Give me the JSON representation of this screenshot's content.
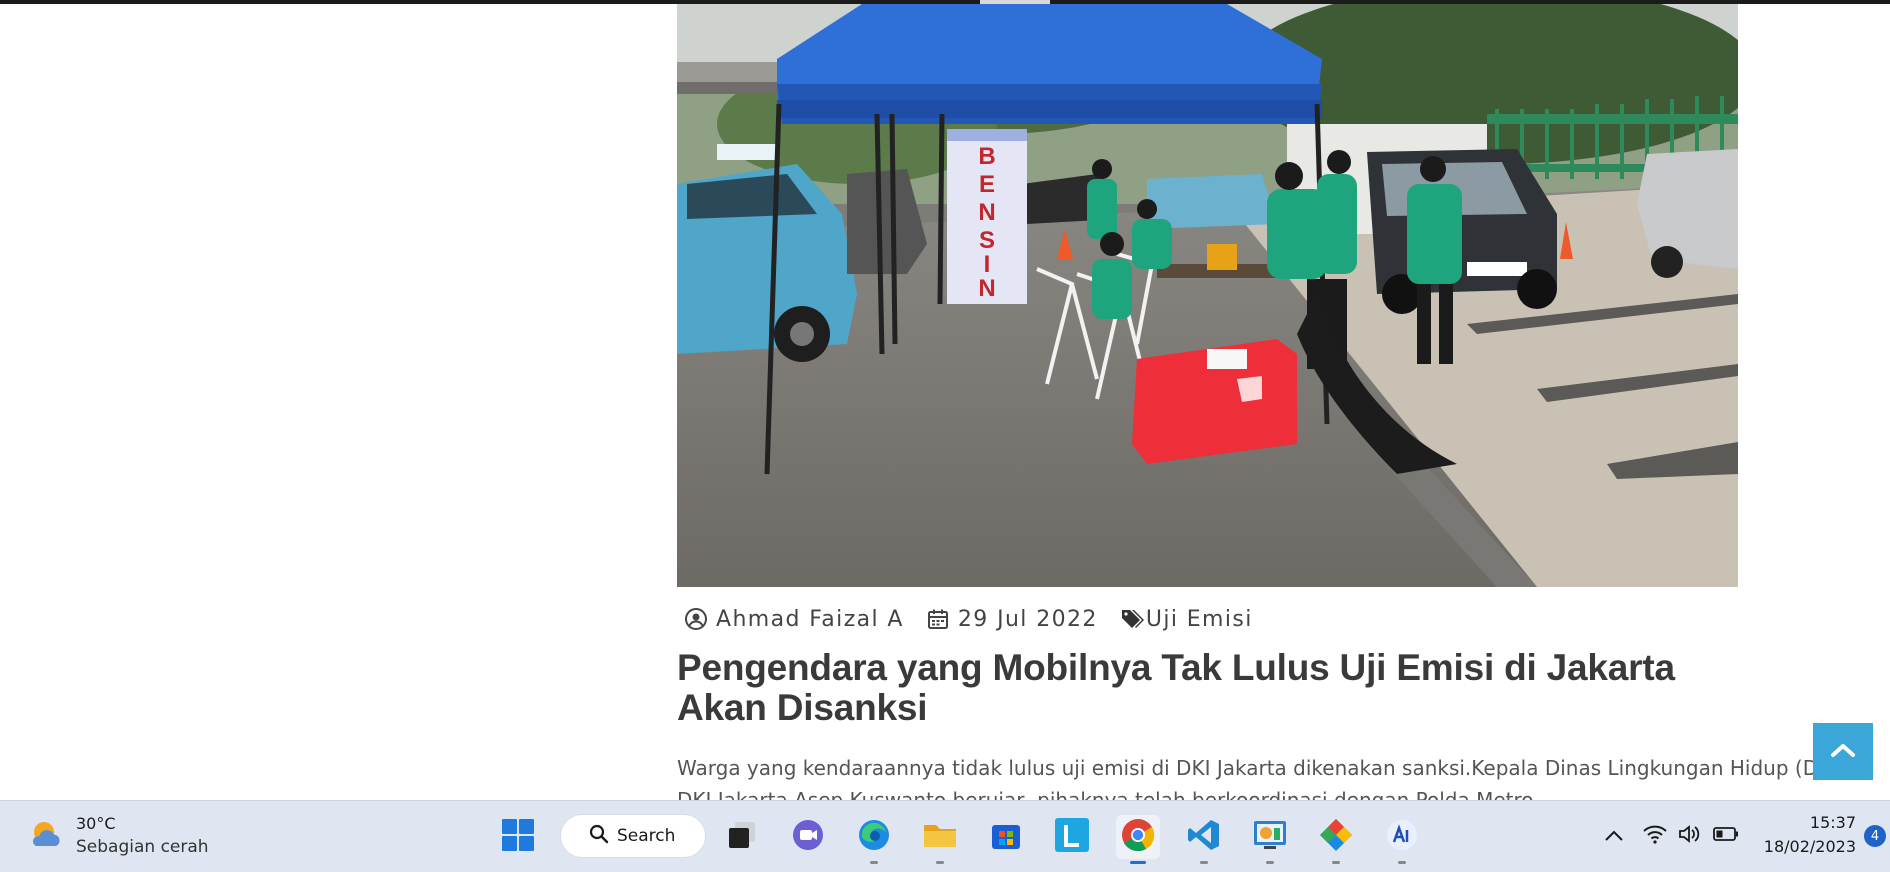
{
  "article": {
    "image_alt": "Uji emisi kendaraan di Jakarta",
    "banner_text": "BENSIN",
    "author": "Ahmad Faizal A",
    "date": "29 Jul 2022",
    "tag": "Uji Emisi",
    "title": "Pengendara yang Mobilnya Tak Lulus Uji Emisi di Jakarta Akan Disanksi",
    "excerpt_line1": "Warga yang kendaraannya tidak lulus uji emisi di DKI Jakarta  dikenakan sanksi.Kepala Dinas Lingkungan Hidup (DLH)",
    "excerpt_line2": "DKI Jakarta Asep Kuswanto berujar, pihaknya telah berkoordinasi dengan Polda Metro"
  },
  "scroll_top": {
    "icon": "chevron-up-icon"
  },
  "taskbar": {
    "weather": {
      "temp": "30°C",
      "condition": "Sebagian cerah",
      "icon": "partly-sunny-icon"
    },
    "search_label": "Search",
    "apps": [
      {
        "name": "start",
        "icon": "windows-start-icon"
      },
      {
        "name": "task-view",
        "icon": "task-view-icon"
      },
      {
        "name": "teams-chat",
        "icon": "video-chat-icon"
      },
      {
        "name": "edge",
        "icon": "edge-browser-icon"
      },
      {
        "name": "file-explorer",
        "icon": "folder-icon"
      },
      {
        "name": "store",
        "icon": "store-icon"
      },
      {
        "name": "l-app",
        "icon": "l-letter-icon"
      },
      {
        "name": "chrome",
        "icon": "chrome-icon"
      },
      {
        "name": "vscode",
        "icon": "vscode-icon"
      },
      {
        "name": "app-chart",
        "icon": "chart-app-icon"
      },
      {
        "name": "app-diamond",
        "icon": "diamond-app-icon"
      },
      {
        "name": "app-ai",
        "icon": "ai-app-icon"
      }
    ],
    "tray": {
      "chevron": "chevron-up-icon",
      "wifi": "wifi-icon",
      "volume": "speaker-icon",
      "battery": "battery-icon"
    },
    "clock": {
      "time": "15:37",
      "date": "18/02/2023"
    },
    "notification_count": "4",
    "colors": {
      "taskbar_bg": "#dfe6f2",
      "accent": "#1e6fd0",
      "scroll_btn": "#3ba7d8"
    }
  }
}
